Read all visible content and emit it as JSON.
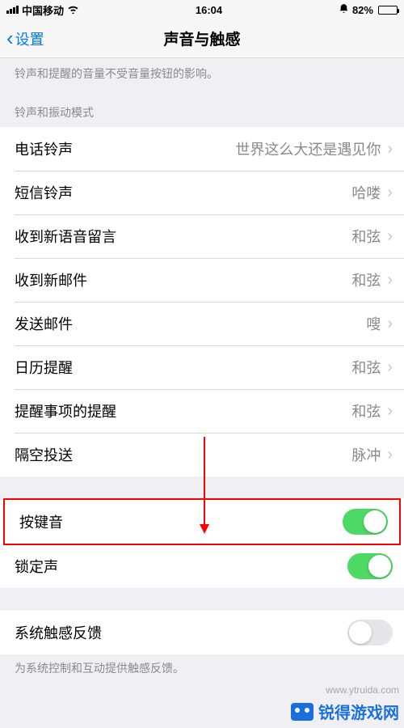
{
  "statusbar": {
    "carrier": "中国移动",
    "time": "16:04",
    "battery_pct": "82%"
  },
  "nav": {
    "back_label": "设置",
    "title": "声音与触感"
  },
  "top_note": "铃声和提醒的音量不受音量按钮的影响。",
  "section_header_ringtone": "铃声和振动模式",
  "ringtone_rows": [
    {
      "label": "电话铃声",
      "value": "世界这么大还是遇见你"
    },
    {
      "label": "短信铃声",
      "value": "哈喽"
    },
    {
      "label": "收到新语音留言",
      "value": "和弦"
    },
    {
      "label": "收到新邮件",
      "value": "和弦"
    },
    {
      "label": "发送邮件",
      "value": "嗖"
    },
    {
      "label": "日历提醒",
      "value": "和弦"
    },
    {
      "label": "提醒事项的提醒",
      "value": "和弦"
    },
    {
      "label": "隔空投送",
      "value": "脉冲"
    }
  ],
  "toggles": {
    "keyboard_clicks": {
      "label": "按键音",
      "on": true
    },
    "lock_sound": {
      "label": "锁定声",
      "on": true
    }
  },
  "haptics": {
    "label": "系统触感反馈",
    "on": false,
    "footer": "为系统控制和互动提供触感反馈。"
  },
  "watermarks": {
    "small": "www.ytruida.com",
    "big": "锐得游戏网"
  }
}
